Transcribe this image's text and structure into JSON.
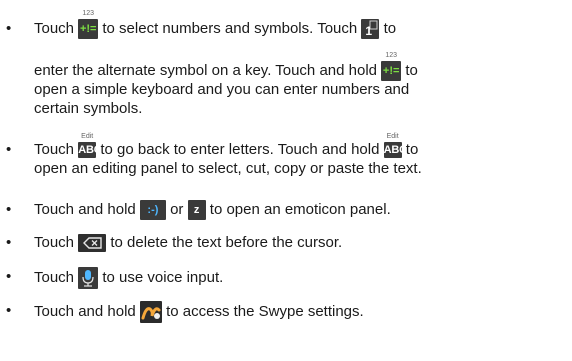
{
  "icons": {
    "numbers_key": {
      "name": "numbers-symbols-key-icon",
      "sup": "123",
      "glyph": "+!="
    },
    "alt_key": {
      "name": "alt-symbol-key-icon",
      "glyph": "1"
    },
    "abc_key": {
      "name": "abc-key-icon",
      "sup": "Edit",
      "glyph": "ABC"
    },
    "smiley_key": {
      "name": "emoticon-key-icon",
      "glyph": ":-)"
    },
    "z_key": {
      "name": "z-key-icon",
      "glyph": "z"
    },
    "backspace_key": {
      "name": "backspace-key-icon"
    },
    "mic_key": {
      "name": "microphone-key-icon"
    },
    "swype_key": {
      "name": "swype-key-icon"
    }
  },
  "bullets": [
    {
      "lines": [
        {
          "a": "Touch ",
          "b": " to select numbers and symbols. Touch ",
          "c": " to"
        },
        {
          "a": "enter the alternate symbol on a key. Touch and hold ",
          "b": " to"
        },
        {
          "a": "open a simple keyboard and you can enter numbers and"
        },
        {
          "a": "certain symbols."
        }
      ]
    },
    {
      "lines": [
        {
          "a": "Touch ",
          "b": " to go back to enter letters. Touch and hold ",
          "c": " to"
        },
        {
          "a": "open an editing panel to select, cut, copy or paste the text."
        }
      ]
    },
    {
      "lines": [
        {
          "a": "Touch and hold ",
          "b": " or ",
          "c": " to open an emoticon panel."
        }
      ]
    },
    {
      "lines": [
        {
          "a": "Touch ",
          "b": " to delete the text before the cursor."
        }
      ]
    },
    {
      "lines": [
        {
          "a": "Touch ",
          "b": " to use voice input."
        }
      ]
    },
    {
      "lines": [
        {
          "a": "Touch and hold ",
          "b": " to access the Swype settings."
        }
      ]
    }
  ]
}
